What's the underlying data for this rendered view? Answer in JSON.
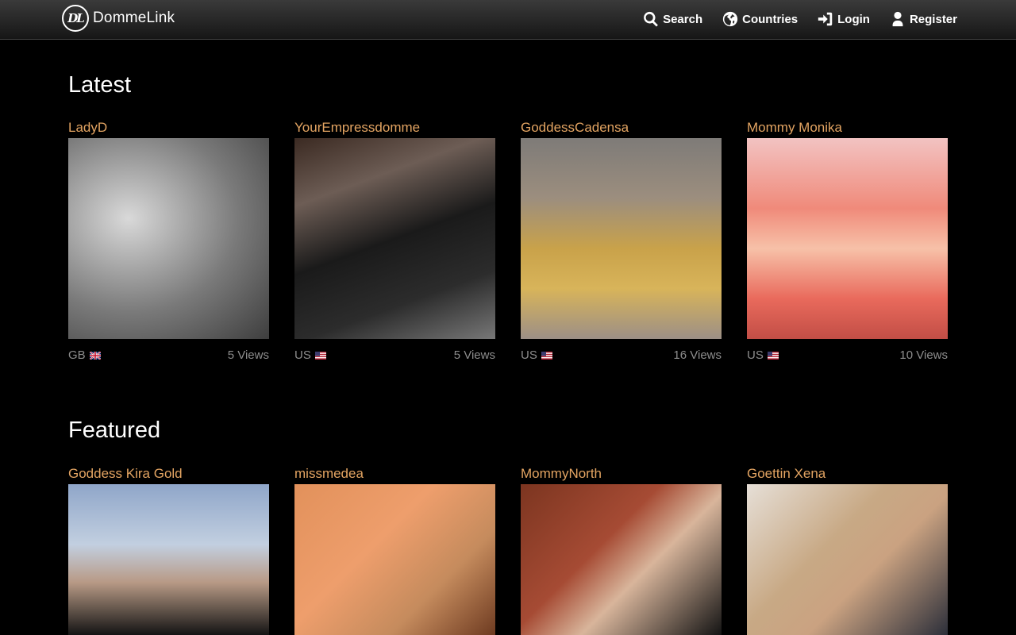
{
  "brand": {
    "name": "DommeLink",
    "logo_text": "DL"
  },
  "nav": {
    "search": "Search",
    "countries": "Countries",
    "login": "Login",
    "register": "Register"
  },
  "latest": {
    "title": "Latest",
    "cards": [
      {
        "name": "LadyD",
        "country": "GB",
        "flag": "gb-flag",
        "views": "5 Views"
      },
      {
        "name": "YourEmpressdomme",
        "country": "US",
        "flag": "us-flag",
        "views": "5 Views"
      },
      {
        "name": "GoddessCadensa",
        "country": "US",
        "flag": "us-flag",
        "views": "16 Views"
      },
      {
        "name": "Mommy Monika",
        "country": "US",
        "flag": "us-flag",
        "views": "10 Views"
      }
    ]
  },
  "featured": {
    "title": "Featured",
    "cards": [
      {
        "name": "Goddess Kira Gold"
      },
      {
        "name": "missmedea"
      },
      {
        "name": "MommyNorth"
      },
      {
        "name": "Goettin Xena"
      }
    ]
  },
  "colors": {
    "accent": "#e3a462",
    "meta": "#8d8d8d",
    "background": "#000000"
  }
}
